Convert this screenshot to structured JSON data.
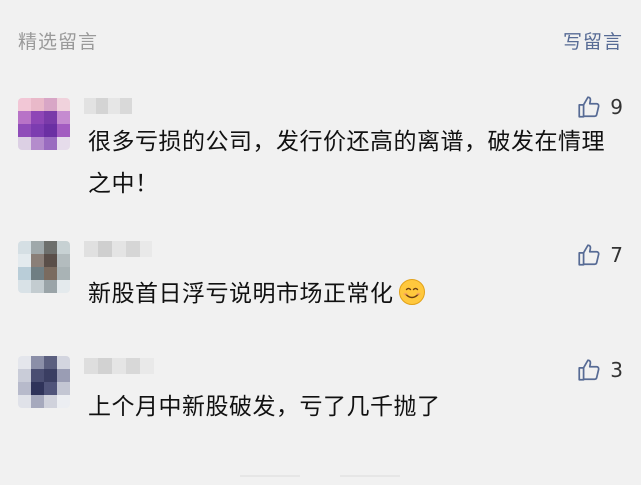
{
  "header": {
    "title": "精选留言",
    "write_label": "写留言"
  },
  "comments": [
    {
      "likes": "9",
      "text": "很多亏损的公司，发行价还高的离谱，破发在情理之中！",
      "avatar_palette": [
        "#f2c7d6",
        "#e9b9c9",
        "#d8a6c6",
        "#f0d2dc",
        "#b873c7",
        "#8e46b6",
        "#7a3aa9",
        "#c58bd0",
        "#8f4cb9",
        "#7c3cb0",
        "#6b2fa3",
        "#a35cc1",
        "#dcd0e4",
        "#b48ccc",
        "#9a6cc0",
        "#e6dceb"
      ]
    },
    {
      "likes": "7",
      "text": "新股首日浮亏说明市场正常化",
      "avatar_palette": [
        "#d5dfe4",
        "#9fa8aa",
        "#6d6f6c",
        "#c7d1d3",
        "#e3eaee",
        "#8a7f78",
        "#5a4f49",
        "#b3bcbe",
        "#b9cdd8",
        "#6f7e83",
        "#7a6b5f",
        "#a9b3b5",
        "#d9e2e7",
        "#c3ccd0",
        "#9aa4a8",
        "#e4eaed"
      ]
    },
    {
      "likes": "3",
      "text": "上个月中新股破发，亏了几千抛了",
      "avatar_palette": [
        "#e4e6ec",
        "#8b8fa8",
        "#5b5f7f",
        "#d3d5df",
        "#c9ccd8",
        "#4a4e72",
        "#3a3e62",
        "#9a9db4",
        "#b7bacb",
        "#2f335a",
        "#50547a",
        "#c3c6d3",
        "#e0e2e9",
        "#a6a9bd",
        "#d0d2dc",
        "#eceef2"
      ]
    }
  ],
  "colors": {
    "background": "#f1f1f1",
    "link": "#576b95",
    "muted": "#9a9a9a"
  },
  "icons": {
    "like": "thumbs-up-icon",
    "emoji": "smiling-face-emoji"
  }
}
